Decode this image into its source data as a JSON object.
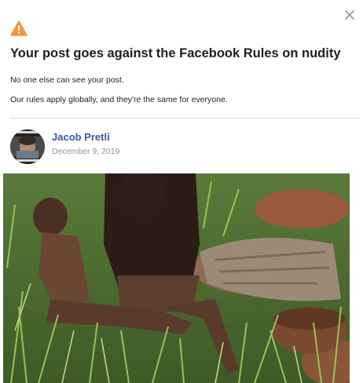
{
  "dialog": {
    "title": "Your post goes against the Facebook Rules on nudity",
    "line1": "No one else can see your post.",
    "line2": "Our rules apply globally, and they're the same for everyone.",
    "close_icon": "close-icon",
    "warning_icon": "warning-icon",
    "warning_color": "#f7923b"
  },
  "post": {
    "author": "Jacob Pretli",
    "date": "December 9, 2019",
    "author_color": "#385898"
  }
}
